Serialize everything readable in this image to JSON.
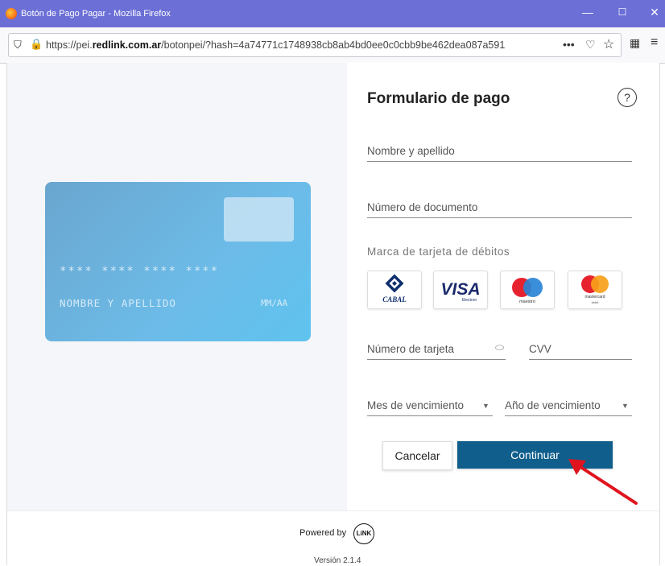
{
  "window": {
    "title": "Botón de Pago Pagar - Mozilla Firefox",
    "min": "—",
    "max": "☐",
    "close": "✕"
  },
  "browser": {
    "url_prefix": "https://pei.",
    "url_domain": "redlink.com.ar",
    "url_rest": "/botonpei/?hash=4a74771c1748938cb8ab4bd0ee0c0cbb9be462dea087a591",
    "more": "•••"
  },
  "card": {
    "number": "**** **** **** ****",
    "holder": "NOMBRE Y APELLIDO",
    "expiry": "MM/AA"
  },
  "form": {
    "title": "Formulario de pago",
    "help": "?",
    "name_placeholder": "Nombre y apellido",
    "document_placeholder": "Número de documento",
    "brand_label": "Marca de tarjeta de débitos",
    "brands": [
      {
        "name": "CABAL"
      },
      {
        "name": "VISA",
        "sub": "Electron"
      },
      {
        "name": "maestro"
      },
      {
        "name": "mastercard",
        "sub": "debit"
      }
    ],
    "card_number_placeholder": "Número de tarjeta",
    "cvv_placeholder": "CVV",
    "month_placeholder": "Mes de vencimiento",
    "year_placeholder": "Año de vencimiento",
    "cancel_label": "Cancelar",
    "continue_label": "Continuar"
  },
  "footer": {
    "powered_by": "Powered by",
    "logo_text": "LiNK",
    "version": "Versión 2.1.4"
  },
  "colors": {
    "titlebar": "#6b6fd6",
    "primary_button": "#0f5e8c",
    "card_gradient_start": "#6aa6cf",
    "card_gradient_end": "#5fc3ee",
    "arrow": "#e0141e"
  }
}
